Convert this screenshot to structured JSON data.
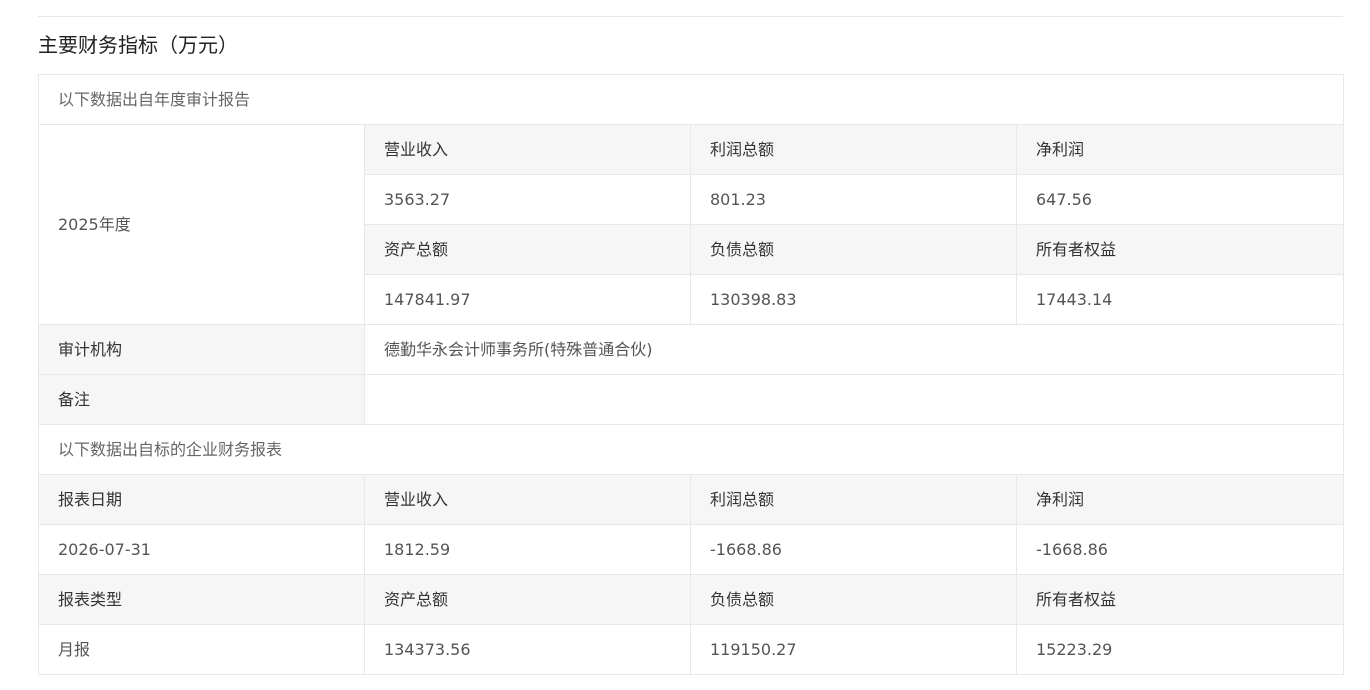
{
  "section": {
    "title": "主要财务指标（万元）"
  },
  "audit_report": {
    "note": "以下数据出自年度审计报告",
    "year_label": "2025年度",
    "headers_row1": [
      "营业收入",
      "利润总额",
      "净利润"
    ],
    "values_row1": [
      "3563.27",
      "801.23",
      "647.56"
    ],
    "headers_row2": [
      "资产总额",
      "负债总额",
      "所有者权益"
    ],
    "values_row2": [
      "147841.97",
      "130398.83",
      "17443.14"
    ],
    "auditor_label": "审计机构",
    "auditor_value": "德勤华永会计师事务所(特殊普通合伙)",
    "remark_label": "备注",
    "remark_value": ""
  },
  "company_report": {
    "note": "以下数据出自标的企业财务报表",
    "date_label": "报表日期",
    "date_value": "2026-07-31",
    "type_label": "报表类型",
    "type_value": "月报",
    "headers_row1": [
      "营业收入",
      "利润总额",
      "净利润"
    ],
    "values_row1": [
      "1812.59",
      "-1668.86",
      "-1668.86"
    ],
    "headers_row2": [
      "资产总额",
      "负债总额",
      "所有者权益"
    ],
    "values_row2": [
      "134373.56",
      "119150.27",
      "15223.29"
    ]
  }
}
